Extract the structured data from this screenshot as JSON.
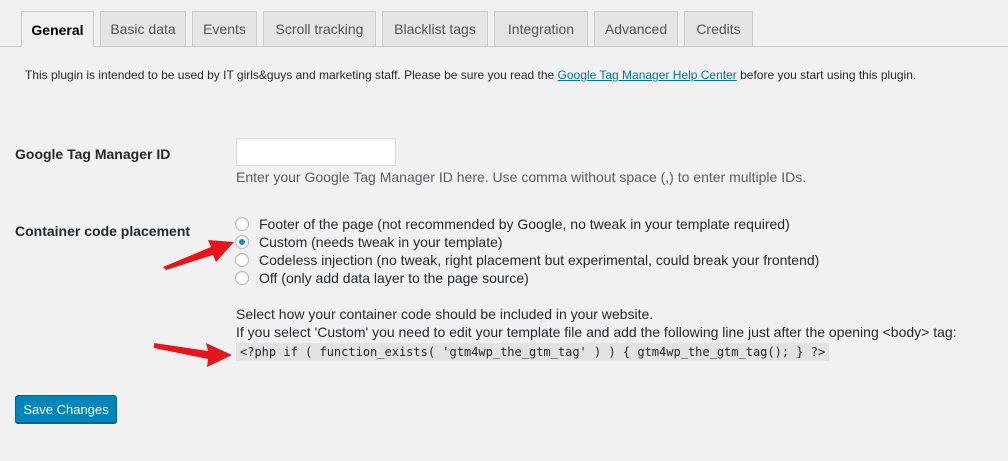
{
  "tabs": [
    {
      "label": "General",
      "active": true
    },
    {
      "label": "Basic data",
      "active": false
    },
    {
      "label": "Events",
      "active": false
    },
    {
      "label": "Scroll tracking",
      "active": false
    },
    {
      "label": "Blacklist tags",
      "active": false
    },
    {
      "label": "Integration",
      "active": false
    },
    {
      "label": "Advanced",
      "active": false
    },
    {
      "label": "Credits",
      "active": false
    }
  ],
  "intro": {
    "before": "This plugin is intended to be used by IT girls&guys and marketing staff. Please be sure you read the ",
    "link": "Google Tag Manager Help Center",
    "after": " before you start using this plugin."
  },
  "gtm_id": {
    "label": "Google Tag Manager ID",
    "value": "",
    "description": "Enter your Google Tag Manager ID here. Use comma without space (,) to enter multiple IDs."
  },
  "placement": {
    "label": "Container code placement",
    "options": [
      {
        "label": "Footer of the page (not recommended by Google, no tweak in your template required)",
        "checked": false
      },
      {
        "label": "Custom (needs tweak in your template)",
        "checked": true
      },
      {
        "label": "Codeless injection (no tweak, right placement but experimental, could break your frontend)",
        "checked": false
      },
      {
        "label": "Off (only add data layer to the page source)",
        "checked": false
      }
    ],
    "info_line1": "Select how your container code should be included in your website.",
    "info_line2": "If you select 'Custom' you need to edit your template file and add the following line just after the opening <body> tag:",
    "code": "<?php if ( function_exists( 'gtm4wp_the_gtm_tag' ) ) { gtm4wp_the_gtm_tag(); } ?>"
  },
  "save_button": "Save Changes",
  "colors": {
    "background": "#f1f1f1",
    "link": "#0073aa",
    "primary_button": "#0085ba",
    "radio_checked": "#1e8cbe",
    "annotation_arrow": "#e8141b"
  }
}
